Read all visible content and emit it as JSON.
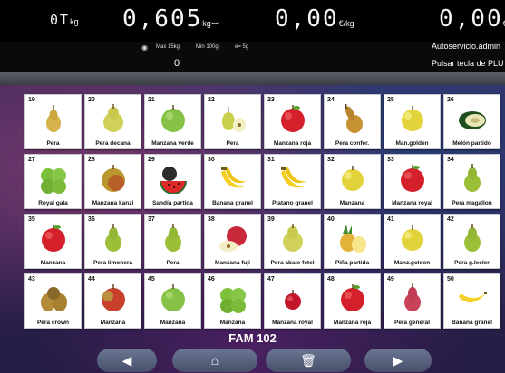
{
  "display": {
    "tare_value": "0T",
    "tare_unit": "kg",
    "weight_value": "0,605",
    "weight_unit": "kg",
    "price_value": "0,00",
    "price_unit": "€/kg",
    "total_value": "0,00",
    "total_unit": "€",
    "max_spec": "Max 15kg",
    "min_spec": "Min 100g",
    "e_spec": "e= 5g",
    "mode_text": "Autoservicio.admin",
    "count_value": "0",
    "hint_text": "Pulsar tecla de PLU"
  },
  "family_label": "FAM 102",
  "products": [
    {
      "num": "19",
      "label": "Pera",
      "fruit": "pear"
    },
    {
      "num": "20",
      "label": "Pera decana",
      "fruit": "pear-big"
    },
    {
      "num": "21",
      "label": "Manzana verde",
      "fruit": "apple-green"
    },
    {
      "num": "22",
      "label": "Pera",
      "fruit": "pear-cut"
    },
    {
      "num": "23",
      "label": "Manzana roja",
      "fruit": "apple-red"
    },
    {
      "num": "24",
      "label": "Pera confer.",
      "fruit": "pear-long"
    },
    {
      "num": "25",
      "label": "Man.golden",
      "fruit": "apple-yellow"
    },
    {
      "num": "26",
      "label": "Melón partido",
      "fruit": "melon"
    },
    {
      "num": "27",
      "label": "Royal gala",
      "fruit": "apples-green"
    },
    {
      "num": "28",
      "label": "Manzana kanzi",
      "fruit": "apple-kanzi"
    },
    {
      "num": "29",
      "label": "Sandía partida",
      "fruit": "watermelon"
    },
    {
      "num": "30",
      "label": "Banana granel",
      "fruit": "banana"
    },
    {
      "num": "31",
      "label": "Platano granel",
      "fruit": "banana"
    },
    {
      "num": "32",
      "label": "Manzana",
      "fruit": "apple-yellow"
    },
    {
      "num": "33",
      "label": "Manzana royal",
      "fruit": "apple-red"
    },
    {
      "num": "34",
      "label": "Pera magallon",
      "fruit": "pear-green"
    },
    {
      "num": "35",
      "label": "Manzana",
      "fruit": "apple-red"
    },
    {
      "num": "36",
      "label": "Pera limonera",
      "fruit": "pear-green"
    },
    {
      "num": "37",
      "label": "Pera",
      "fruit": "pear-green"
    },
    {
      "num": "38",
      "label": "Manzana fuji",
      "fruit": "apple-cut"
    },
    {
      "num": "39",
      "label": "Pera abate fetel",
      "fruit": "pear-big"
    },
    {
      "num": "40",
      "label": "Piña partida",
      "fruit": "pineapple"
    },
    {
      "num": "41",
      "label": "Manz.golden",
      "fruit": "apple-yellow"
    },
    {
      "num": "42",
      "label": "Pera g.lecler",
      "fruit": "pear-green"
    },
    {
      "num": "43",
      "label": "Pera crown",
      "fruit": "pears-brown"
    },
    {
      "num": "44",
      "label": "Manzana",
      "fruit": "apple-redgreen"
    },
    {
      "num": "45",
      "label": "Manzana",
      "fruit": "apple-green"
    },
    {
      "num": "46",
      "label": "Manzana",
      "fruit": "apples-green"
    },
    {
      "num": "47",
      "label": "Manzana royal",
      "fruit": "apple-red-small"
    },
    {
      "num": "48",
      "label": "Manzana roja",
      "fruit": "apple-red"
    },
    {
      "num": "49",
      "label": "Pera general",
      "fruit": "pear-red"
    },
    {
      "num": "50",
      "label": "Banana granel",
      "fruit": "banana-single"
    }
  ],
  "nav": {
    "prev_icon": "prev-arrow-icon",
    "home_icon": "home-icon",
    "delete_icon": "trash-icon",
    "next_icon": "next-arrow-icon"
  }
}
